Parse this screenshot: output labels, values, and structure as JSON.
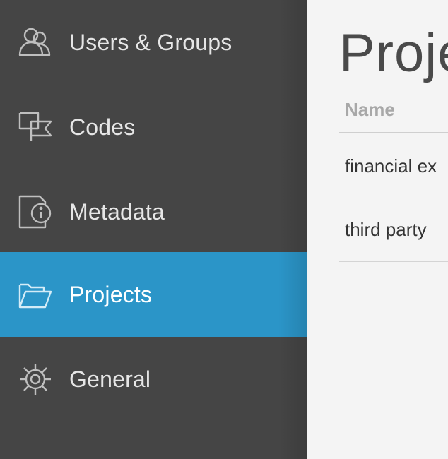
{
  "sidebar": {
    "items": [
      {
        "label": "Users & Groups",
        "icon": "users-icon",
        "active": false
      },
      {
        "label": "Codes",
        "icon": "flag-icon",
        "active": false
      },
      {
        "label": "Metadata",
        "icon": "info-document-icon",
        "active": false
      },
      {
        "label": "Projects",
        "icon": "folder-open-icon",
        "active": true
      },
      {
        "label": "General",
        "icon": "gear-icon",
        "active": false
      }
    ]
  },
  "main": {
    "title": "Proje",
    "table": {
      "columns": [
        "Name"
      ],
      "rows": [
        "financial ex",
        "third party"
      ]
    }
  },
  "colors": {
    "sidebar_bg": "#454545",
    "active_bg": "#2b95c8",
    "main_bg": "#f4f4f4"
  }
}
